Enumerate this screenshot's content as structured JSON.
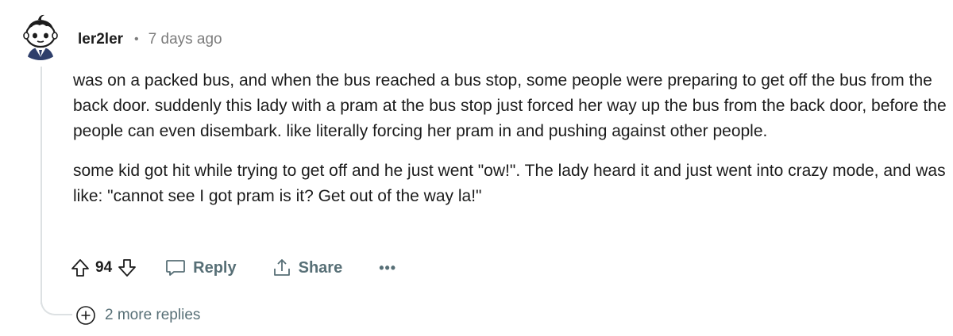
{
  "comment": {
    "username": "ler2ler",
    "separator": "•",
    "timestamp": "7 days ago",
    "paragraphs": [
      "was on a packed bus, and when the bus reached a bus stop, some people were preparing to get off the bus from the back door. suddenly this lady with a pram at the bus stop just forced her way up the bus from the back door, before the people can even disembark. like literally forcing her pram in and pushing against other people.",
      "some kid got hit while trying to get off and he just went \"ow!\". The lady heard it and just went into crazy mode, and was like: \"cannot see I got pram is it? Get out of the way la!\""
    ],
    "score": "94",
    "actions": {
      "reply_label": "Reply",
      "share_label": "Share",
      "more_label": "•••"
    },
    "more_replies_label": "2 more replies"
  },
  "colors": {
    "text": "#1c1c1c",
    "muted": "#576f76",
    "meta": "#7c7c7c",
    "thread": "#dde1e3"
  },
  "icons": {
    "avatar": "snoo-avatar",
    "upvote": "upvote-arrow-icon",
    "downvote": "downvote-arrow-icon",
    "reply": "speech-bubble-icon",
    "share": "share-arrow-icon",
    "more": "ellipsis-icon",
    "expand": "plus-circle-icon"
  }
}
